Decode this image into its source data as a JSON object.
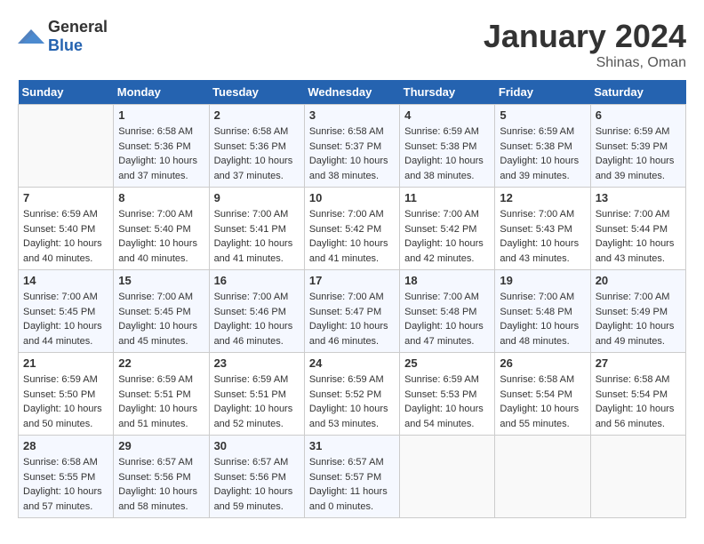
{
  "header": {
    "logo_general": "General",
    "logo_blue": "Blue",
    "month_title": "January 2024",
    "location": "Shinas, Oman"
  },
  "weekdays": [
    "Sunday",
    "Monday",
    "Tuesday",
    "Wednesday",
    "Thursday",
    "Friday",
    "Saturday"
  ],
  "weeks": [
    [
      {
        "day": "",
        "sunrise": "",
        "sunset": "",
        "daylight": ""
      },
      {
        "day": "1",
        "sunrise": "Sunrise: 6:58 AM",
        "sunset": "Sunset: 5:36 PM",
        "daylight": "Daylight: 10 hours and 37 minutes."
      },
      {
        "day": "2",
        "sunrise": "Sunrise: 6:58 AM",
        "sunset": "Sunset: 5:36 PM",
        "daylight": "Daylight: 10 hours and 37 minutes."
      },
      {
        "day": "3",
        "sunrise": "Sunrise: 6:58 AM",
        "sunset": "Sunset: 5:37 PM",
        "daylight": "Daylight: 10 hours and 38 minutes."
      },
      {
        "day": "4",
        "sunrise": "Sunrise: 6:59 AM",
        "sunset": "Sunset: 5:38 PM",
        "daylight": "Daylight: 10 hours and 38 minutes."
      },
      {
        "day": "5",
        "sunrise": "Sunrise: 6:59 AM",
        "sunset": "Sunset: 5:38 PM",
        "daylight": "Daylight: 10 hours and 39 minutes."
      },
      {
        "day": "6",
        "sunrise": "Sunrise: 6:59 AM",
        "sunset": "Sunset: 5:39 PM",
        "daylight": "Daylight: 10 hours and 39 minutes."
      }
    ],
    [
      {
        "day": "7",
        "sunrise": "Sunrise: 6:59 AM",
        "sunset": "Sunset: 5:40 PM",
        "daylight": "Daylight: 10 hours and 40 minutes."
      },
      {
        "day": "8",
        "sunrise": "Sunrise: 7:00 AM",
        "sunset": "Sunset: 5:40 PM",
        "daylight": "Daylight: 10 hours and 40 minutes."
      },
      {
        "day": "9",
        "sunrise": "Sunrise: 7:00 AM",
        "sunset": "Sunset: 5:41 PM",
        "daylight": "Daylight: 10 hours and 41 minutes."
      },
      {
        "day": "10",
        "sunrise": "Sunrise: 7:00 AM",
        "sunset": "Sunset: 5:42 PM",
        "daylight": "Daylight: 10 hours and 41 minutes."
      },
      {
        "day": "11",
        "sunrise": "Sunrise: 7:00 AM",
        "sunset": "Sunset: 5:42 PM",
        "daylight": "Daylight: 10 hours and 42 minutes."
      },
      {
        "day": "12",
        "sunrise": "Sunrise: 7:00 AM",
        "sunset": "Sunset: 5:43 PM",
        "daylight": "Daylight: 10 hours and 43 minutes."
      },
      {
        "day": "13",
        "sunrise": "Sunrise: 7:00 AM",
        "sunset": "Sunset: 5:44 PM",
        "daylight": "Daylight: 10 hours and 43 minutes."
      }
    ],
    [
      {
        "day": "14",
        "sunrise": "Sunrise: 7:00 AM",
        "sunset": "Sunset: 5:45 PM",
        "daylight": "Daylight: 10 hours and 44 minutes."
      },
      {
        "day": "15",
        "sunrise": "Sunrise: 7:00 AM",
        "sunset": "Sunset: 5:45 PM",
        "daylight": "Daylight: 10 hours and 45 minutes."
      },
      {
        "day": "16",
        "sunrise": "Sunrise: 7:00 AM",
        "sunset": "Sunset: 5:46 PM",
        "daylight": "Daylight: 10 hours and 46 minutes."
      },
      {
        "day": "17",
        "sunrise": "Sunrise: 7:00 AM",
        "sunset": "Sunset: 5:47 PM",
        "daylight": "Daylight: 10 hours and 46 minutes."
      },
      {
        "day": "18",
        "sunrise": "Sunrise: 7:00 AM",
        "sunset": "Sunset: 5:48 PM",
        "daylight": "Daylight: 10 hours and 47 minutes."
      },
      {
        "day": "19",
        "sunrise": "Sunrise: 7:00 AM",
        "sunset": "Sunset: 5:48 PM",
        "daylight": "Daylight: 10 hours and 48 minutes."
      },
      {
        "day": "20",
        "sunrise": "Sunrise: 7:00 AM",
        "sunset": "Sunset: 5:49 PM",
        "daylight": "Daylight: 10 hours and 49 minutes."
      }
    ],
    [
      {
        "day": "21",
        "sunrise": "Sunrise: 6:59 AM",
        "sunset": "Sunset: 5:50 PM",
        "daylight": "Daylight: 10 hours and 50 minutes."
      },
      {
        "day": "22",
        "sunrise": "Sunrise: 6:59 AM",
        "sunset": "Sunset: 5:51 PM",
        "daylight": "Daylight: 10 hours and 51 minutes."
      },
      {
        "day": "23",
        "sunrise": "Sunrise: 6:59 AM",
        "sunset": "Sunset: 5:51 PM",
        "daylight": "Daylight: 10 hours and 52 minutes."
      },
      {
        "day": "24",
        "sunrise": "Sunrise: 6:59 AM",
        "sunset": "Sunset: 5:52 PM",
        "daylight": "Daylight: 10 hours and 53 minutes."
      },
      {
        "day": "25",
        "sunrise": "Sunrise: 6:59 AM",
        "sunset": "Sunset: 5:53 PM",
        "daylight": "Daylight: 10 hours and 54 minutes."
      },
      {
        "day": "26",
        "sunrise": "Sunrise: 6:58 AM",
        "sunset": "Sunset: 5:54 PM",
        "daylight": "Daylight: 10 hours and 55 minutes."
      },
      {
        "day": "27",
        "sunrise": "Sunrise: 6:58 AM",
        "sunset": "Sunset: 5:54 PM",
        "daylight": "Daylight: 10 hours and 56 minutes."
      }
    ],
    [
      {
        "day": "28",
        "sunrise": "Sunrise: 6:58 AM",
        "sunset": "Sunset: 5:55 PM",
        "daylight": "Daylight: 10 hours and 57 minutes."
      },
      {
        "day": "29",
        "sunrise": "Sunrise: 6:57 AM",
        "sunset": "Sunset: 5:56 PM",
        "daylight": "Daylight: 10 hours and 58 minutes."
      },
      {
        "day": "30",
        "sunrise": "Sunrise: 6:57 AM",
        "sunset": "Sunset: 5:56 PM",
        "daylight": "Daylight: 10 hours and 59 minutes."
      },
      {
        "day": "31",
        "sunrise": "Sunrise: 6:57 AM",
        "sunset": "Sunset: 5:57 PM",
        "daylight": "Daylight: 11 hours and 0 minutes."
      },
      {
        "day": "",
        "sunrise": "",
        "sunset": "",
        "daylight": ""
      },
      {
        "day": "",
        "sunrise": "",
        "sunset": "",
        "daylight": ""
      },
      {
        "day": "",
        "sunrise": "",
        "sunset": "",
        "daylight": ""
      }
    ]
  ]
}
